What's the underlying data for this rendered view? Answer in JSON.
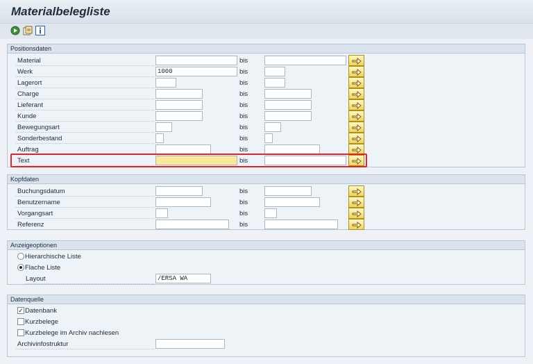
{
  "title": "Materialbelegliste",
  "toolbar": {
    "icons": [
      "execute-icon",
      "get-variant-icon",
      "info-icon"
    ]
  },
  "bis_label": "bis",
  "positionsdaten": {
    "title": "Positionsdaten",
    "rows": [
      {
        "label": "Material",
        "from": "",
        "to": ""
      },
      {
        "label": "Werk",
        "from": "1000",
        "to": ""
      },
      {
        "label": "Lagerort",
        "from": "",
        "to": ""
      },
      {
        "label": "Charge",
        "from": "",
        "to": ""
      },
      {
        "label": "Lieferant",
        "from": "",
        "to": ""
      },
      {
        "label": "Kunde",
        "from": "",
        "to": ""
      },
      {
        "label": "Bewegungsart",
        "from": "",
        "to": ""
      },
      {
        "label": "Sonderbestand",
        "from": "",
        "to": ""
      },
      {
        "label": "Auftrag",
        "from": "",
        "to": ""
      },
      {
        "label": "Text",
        "from": "",
        "to": ""
      }
    ]
  },
  "kopfdaten": {
    "title": "Kopfdaten",
    "rows": [
      {
        "label": "Buchungsdatum",
        "from": "",
        "to": ""
      },
      {
        "label": "Benutzername",
        "from": "",
        "to": ""
      },
      {
        "label": "Vorgangsart",
        "from": "",
        "to": ""
      },
      {
        "label": "Referenz",
        "from": "",
        "to": ""
      }
    ]
  },
  "anzeigeoptionen": {
    "title": "Anzeigeoptionen",
    "radio_hierarchisch": "Hierarchische Liste",
    "radio_flach": "Flache Liste",
    "selected": "flach",
    "layout_label": "Layout",
    "layout_value": "/ERSA WA"
  },
  "datenquelle": {
    "title": "Datenquelle",
    "cb_datenbank": "Datenbank",
    "cb_kurzbelege": "Kurzbelege",
    "cb_archiv": "Kurzbelege im Archiv nachlesen",
    "datenbank_checked": "✓",
    "archiv_label": "Archivinfostruktur",
    "archiv_value": ""
  },
  "colors": {
    "highlight": "#e0232c",
    "focused_field": "#fbe99a"
  }
}
